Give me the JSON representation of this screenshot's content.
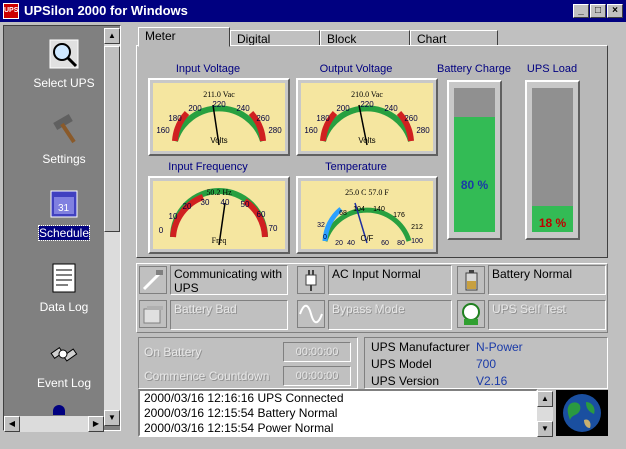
{
  "window": {
    "title": "UPSilon 2000 for Windows",
    "icon_text": "UPS"
  },
  "sidebar": {
    "items": [
      {
        "label": "Select UPS",
        "icon": "magnifier-icon"
      },
      {
        "label": "Settings",
        "icon": "hammer-icon"
      },
      {
        "label": "Schedule",
        "icon": "calendar-icon"
      },
      {
        "label": "Data Log",
        "icon": "document-icon"
      },
      {
        "label": "Event Log",
        "icon": "satellite-icon"
      }
    ],
    "selected": "Schedule"
  },
  "tabs": [
    {
      "label": "Meter"
    },
    {
      "label": "Digital"
    },
    {
      "label": "Block"
    },
    {
      "label": "Chart"
    }
  ],
  "meters": {
    "input_voltage": {
      "label": "Input Voltage",
      "reading": "211.0 Vac",
      "unit": "Volts",
      "ticks": [
        "160",
        "180",
        "200",
        "220",
        "240",
        "260",
        "280"
      ]
    },
    "output_voltage": {
      "label": "Output Voltage",
      "reading": "210.0 Vac",
      "unit": "Volts",
      "ticks": [
        "160",
        "180",
        "200",
        "220",
        "240",
        "260",
        "280"
      ]
    },
    "input_frequency": {
      "label": "Input Frequency",
      "reading": "50.2 Hz",
      "unit": "Freq",
      "ticks": [
        "0",
        "10",
        "20",
        "30",
        "40",
        "50",
        "60",
        "70"
      ]
    },
    "temperature": {
      "label": "Temperature",
      "reading": "25.0 C   57.0 F",
      "unit": "C/F",
      "ticks_outer": [
        "68",
        "104",
        "140",
        "176",
        "212"
      ],
      "ticks_inner": [
        "32",
        "0",
        "20",
        "40",
        "60",
        "80",
        "100"
      ]
    }
  },
  "battery_charge": {
    "label": "Battery Charge",
    "value": "80 %",
    "level": 0.8
  },
  "ups_load": {
    "label": "UPS Load",
    "value": "18 %",
    "level": 0.18
  },
  "status": {
    "communicating": "Communicating with UPS",
    "ac_input": "AC Input Normal",
    "battery_normal": "Battery Normal",
    "battery_bad": "Battery Bad",
    "bypass_mode": "Bypass Mode",
    "self_test": "UPS Self Test"
  },
  "timers": {
    "on_battery_label": "On Battery",
    "on_battery_value": "00:00:00",
    "countdown_label": "Commence Countdown",
    "countdown_value": "00:00:00"
  },
  "ups_info": {
    "manufacturer_label": "UPS Manufacturer",
    "manufacturer": "N-Power",
    "model_label": "UPS Model",
    "model": "700",
    "version_label": "UPS Version",
    "version": "V2.16"
  },
  "event_log": [
    "2000/03/16 12:16:16  UPS Connected",
    "2000/03/16 12:15:54  Battery Normal",
    "2000/03/16 12:15:54  Power Normal"
  ],
  "colors": {
    "titlebar": "#000080",
    "gauge_green": "#33bb55",
    "value_blue": "#1a3aa8",
    "load_red": "#c00000"
  }
}
